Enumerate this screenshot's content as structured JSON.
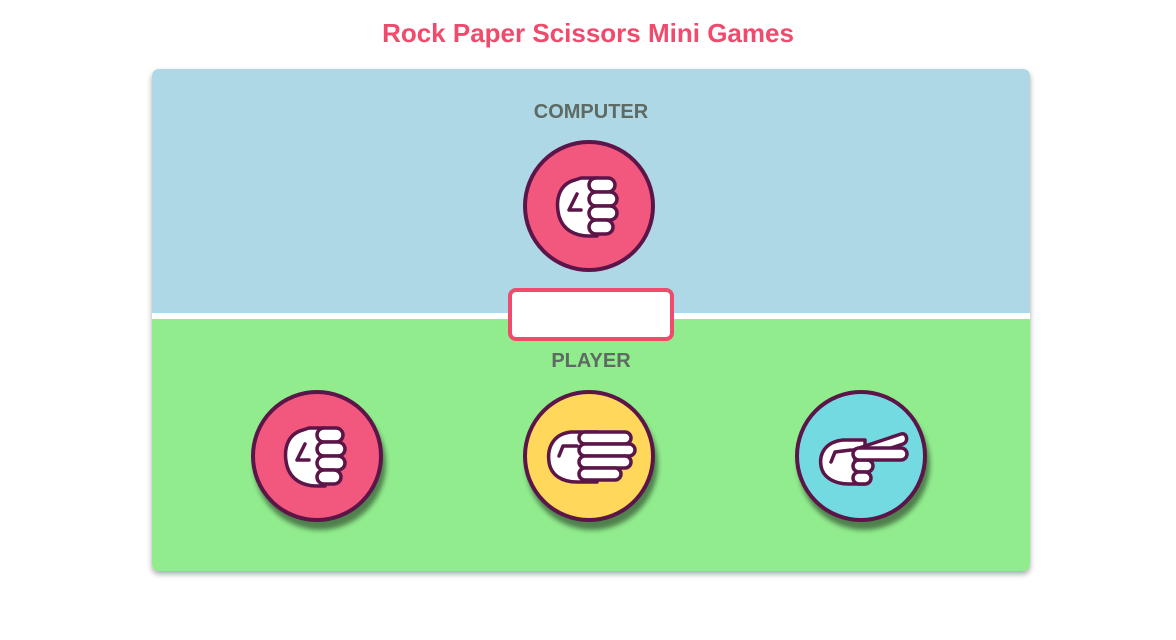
{
  "page": {
    "title": "Rock Paper Scissors Mini Games"
  },
  "computer": {
    "label": "COMPUTER",
    "choice": "rock"
  },
  "result": {
    "text": ""
  },
  "player": {
    "label": "PLAYER",
    "choices": [
      {
        "name": "rock",
        "icon": "rock-hand-icon"
      },
      {
        "name": "paper",
        "icon": "paper-hand-icon"
      },
      {
        "name": "scissors",
        "icon": "scissors-hand-icon"
      }
    ]
  },
  "colors": {
    "title": "#f04a6c",
    "rock": "#f2577e",
    "paper": "#ffd75a",
    "scissors": "#74dae1",
    "outline": "#5c1548",
    "computer_bg": "#aed8e5",
    "player_bg": "#90ec8d",
    "label": "#5e6a63"
  }
}
